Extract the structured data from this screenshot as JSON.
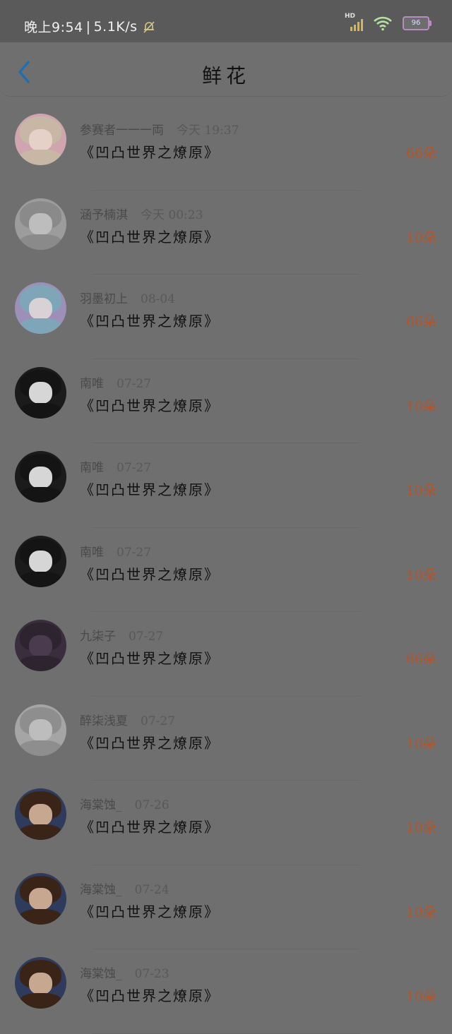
{
  "status_bar": {
    "time": "晚上9:54",
    "speed": "5.1K/s",
    "network_badge": "HD",
    "battery": "96"
  },
  "header": {
    "title": "鲜花",
    "back_icon": "chevron-left-icon"
  },
  "rows": [
    {
      "name": "参赛者一一一両",
      "date": "今天 19:37",
      "work": "《凹凸世界之燎原》",
      "count": "66朵",
      "avatar_colors": [
        "#c9b7a5",
        "#e5d1c8",
        "#cfa5b0"
      ]
    },
    {
      "name": "涵予楠淇",
      "date": "今天 00:23",
      "work": "《凹凸世界之燎原》",
      "count": "10朵",
      "avatar_colors": [
        "#8a8a8a",
        "#bdbdbd",
        "#9c9c9c"
      ]
    },
    {
      "name": "羽墨初上",
      "date": "08-04",
      "work": "《凹凸世界之燎原》",
      "count": "66朵",
      "avatar_colors": [
        "#7fa6b8",
        "#d8d2d6",
        "#9d8fb8"
      ]
    },
    {
      "name": "南唯",
      "date": "07-27",
      "work": "《凹凸世界之燎原》",
      "count": "10朵",
      "avatar_colors": [
        "#141414",
        "#d6d6d6",
        "#1b1b1b"
      ]
    },
    {
      "name": "南唯",
      "date": "07-27",
      "work": "《凹凸世界之燎原》",
      "count": "10朵",
      "avatar_colors": [
        "#141414",
        "#d6d6d6",
        "#1b1b1b"
      ]
    },
    {
      "name": "南唯",
      "date": "07-27",
      "work": "《凹凸世界之燎原》",
      "count": "10朵",
      "avatar_colors": [
        "#141414",
        "#d6d6d6",
        "#1b1b1b"
      ]
    },
    {
      "name": "九柒子",
      "date": "07-27",
      "work": "《凹凸世界之燎原》",
      "count": "66朵",
      "avatar_colors": [
        "#2e2430",
        "#4a3b4e",
        "#3a2d3d"
      ]
    },
    {
      "name": "醉柒浅夏",
      "date": "07-27",
      "work": "《凹凸世界之燎原》",
      "count": "10朵",
      "avatar_colors": [
        "#8e8e8e",
        "#bdbdbd",
        "#a5a5a5"
      ]
    },
    {
      "name": "海棠蚀_",
      "date": "07-26",
      "work": "《凹凸世界之燎原》",
      "count": "10朵",
      "avatar_colors": [
        "#3a2418",
        "#c8a791",
        "#2e3b5c"
      ]
    },
    {
      "name": "海棠蚀_",
      "date": "07-24",
      "work": "《凹凸世界之燎原》",
      "count": "10朵",
      "avatar_colors": [
        "#3a2418",
        "#c8a791",
        "#2e3b5c"
      ]
    },
    {
      "name": "海棠蚀_",
      "date": "07-23",
      "work": "《凹凸世界之燎原》",
      "count": "10朵",
      "avatar_colors": [
        "#3a2418",
        "#c8a791",
        "#2e3b5c"
      ]
    }
  ]
}
